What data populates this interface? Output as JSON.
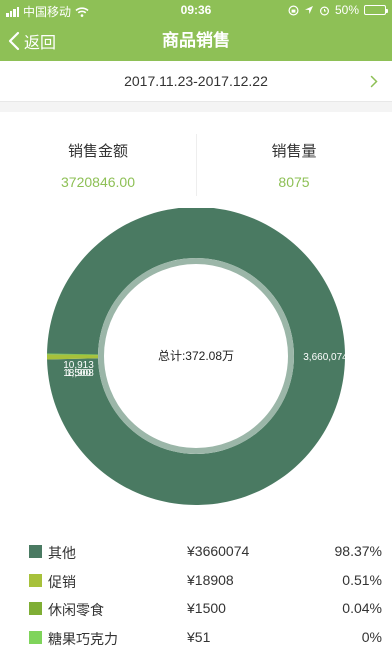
{
  "status_bar": {
    "carrier": "中国移动",
    "time": "09:36",
    "battery": "50%",
    "battery_level": 0.5
  },
  "navbar": {
    "back_label": "返回",
    "title": "商品销售"
  },
  "date_range": "2017.11.23-2017.12.22",
  "summary": {
    "amount_label": "销售金额",
    "amount_value": "3720846.00",
    "qty_label": "销售量",
    "qty_value": "8075"
  },
  "colors": {
    "accent": "#8ec056",
    "series": [
      "#4a7a62",
      "#a7c13b",
      "#7fae35",
      "#7fd45b"
    ],
    "ring_inner": "#9bb6a8"
  },
  "chart_data": {
    "type": "pie",
    "donut": true,
    "center_text": "总计:372.08万",
    "categories": [
      "其他",
      "促销",
      "休闲零食",
      "糖果巧克力"
    ],
    "values": [
      3660074,
      18908,
      1500,
      51
    ],
    "data_labels": [
      "3,660,074",
      "18,908",
      "1,500",
      "51"
    ],
    "slice_label_start": "10,913"
  },
  "legend": [
    {
      "name": "其他",
      "amount": "¥3660074",
      "percent": "98.37%"
    },
    {
      "name": "促销",
      "amount": "¥18908",
      "percent": "0.51%"
    },
    {
      "name": "休闲零食",
      "amount": "¥1500",
      "percent": "0.04%"
    },
    {
      "name": "糖果巧克力",
      "amount": "¥51",
      "percent": "0%"
    }
  ]
}
